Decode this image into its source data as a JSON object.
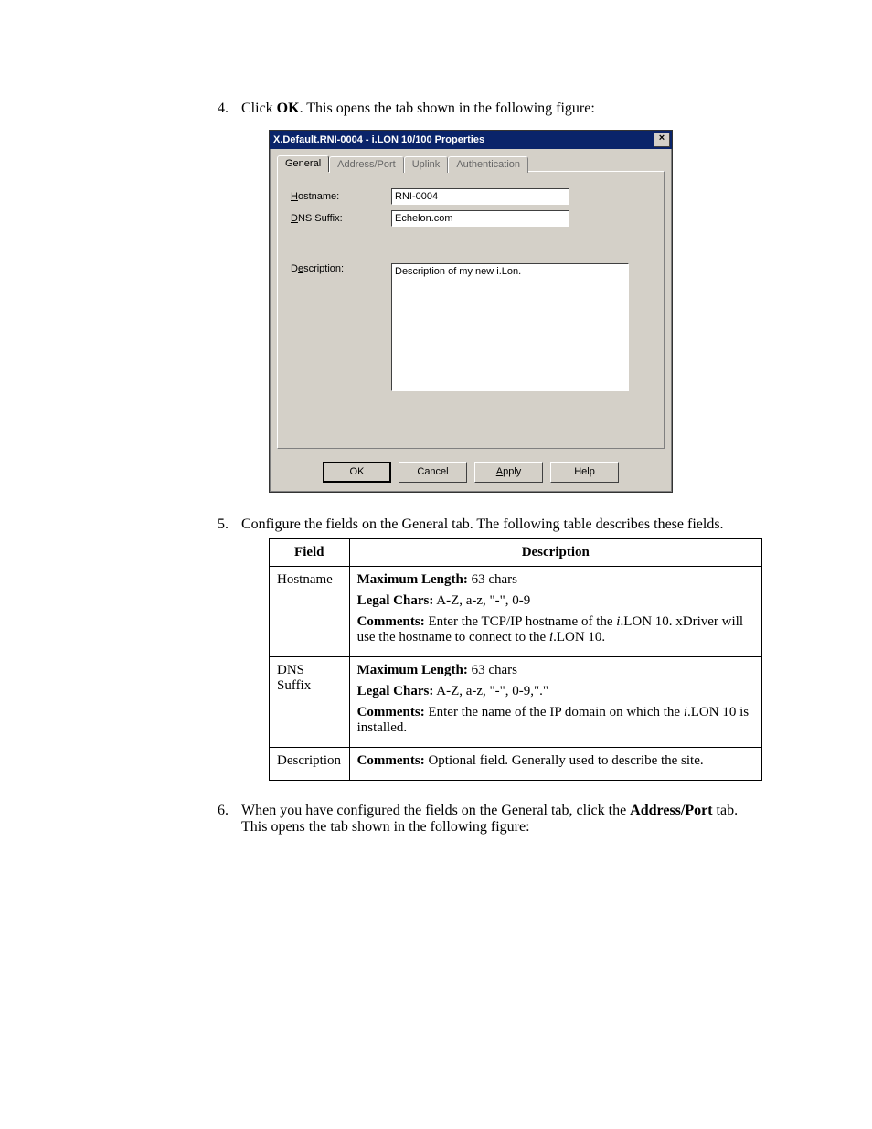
{
  "steps": {
    "s4_num": "4.",
    "s4_pre": "Click ",
    "s4_bold": "OK",
    "s4_post": ". This opens the tab shown in the following figure:",
    "s5_num": "5.",
    "s5_text": "Configure the fields on the General tab. The following table describes these fields.",
    "s6_num": "6.",
    "s6_pre": "When you have configured the fields on the General tab, click the ",
    "s6_bold": "Address/Port",
    "s6_post": " tab. This opens the tab shown in the following figure:"
  },
  "dialog": {
    "title": "X.Default.RNI-0004 - i.LON 10/100 Properties",
    "close": "×",
    "tabs": {
      "general": "General",
      "address": "Address/Port",
      "uplink": "Uplink",
      "auth": "Authentication"
    },
    "labels": {
      "hostname_u": "H",
      "hostname_rest": "ostname:",
      "dns_u": "D",
      "dns_rest": "NS Suffix:",
      "desc_pre": "D",
      "desc_u": "e",
      "desc_rest": "scription:"
    },
    "values": {
      "hostname": "RNI-0004",
      "dns": "Echelon.com",
      "description": "Description of my new i.Lon."
    },
    "buttons": {
      "ok": "OK",
      "cancel": "Cancel",
      "apply_u": "A",
      "apply_rest": "pply",
      "help": "Help"
    }
  },
  "table": {
    "hdr_field": "Field",
    "hdr_desc": "Description",
    "rows": [
      {
        "field": "Hostname",
        "lines": [
          {
            "b": "Maximum Length:",
            "t": " 63 chars"
          },
          {
            "b": "Legal Chars:",
            "t": " A-Z, a-z, \"-\", 0-9"
          },
          {
            "b": "Comments:",
            "t": " Enter the TCP/IP hostname of the ",
            "i": "i",
            "t2": ".LON 10. xDriver will use the hostname to connect to the ",
            "i2": "i",
            "t3": ".LON 10."
          }
        ]
      },
      {
        "field": "DNS Suffix",
        "lines": [
          {
            "b": "Maximum Length:",
            "t": " 63 chars"
          },
          {
            "b": "Legal Chars:",
            "t": " A-Z, a-z, \"-\", 0-9,\".\""
          },
          {
            "b": "Comments:",
            "t": " Enter the name of the IP domain on which the ",
            "i": "i",
            "t2": ".LON 10 is installed."
          }
        ]
      },
      {
        "field": "Description",
        "lines": [
          {
            "b": "Comments:",
            "t": " Optional field. Generally used to describe the site."
          }
        ]
      }
    ]
  }
}
